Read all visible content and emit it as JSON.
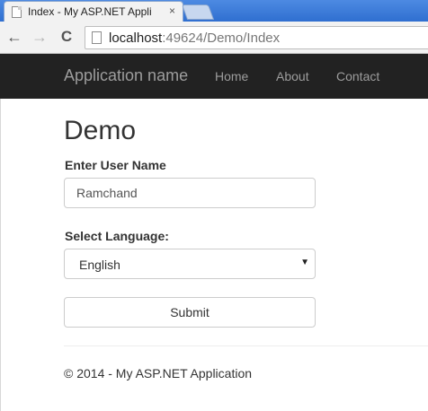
{
  "browser": {
    "tab_title": "Index - My ASP.NET Appli",
    "tab_close": "×",
    "url_host": "localhost",
    "url_path": ":49624/Demo/Index",
    "back_glyph": "←",
    "forward_glyph": "→",
    "reload_glyph": "C"
  },
  "navbar": {
    "brand": "Application name",
    "links": [
      "Home",
      "About",
      "Contact"
    ]
  },
  "page": {
    "title": "Demo",
    "user_label": "Enter User Name",
    "user_value": "Ramchand",
    "language_label": "Select Language:",
    "language_selected": "English",
    "select_arrow": "▼",
    "submit_label": "Submit"
  },
  "footer": {
    "text": "© 2014 - My ASP.NET Application"
  }
}
